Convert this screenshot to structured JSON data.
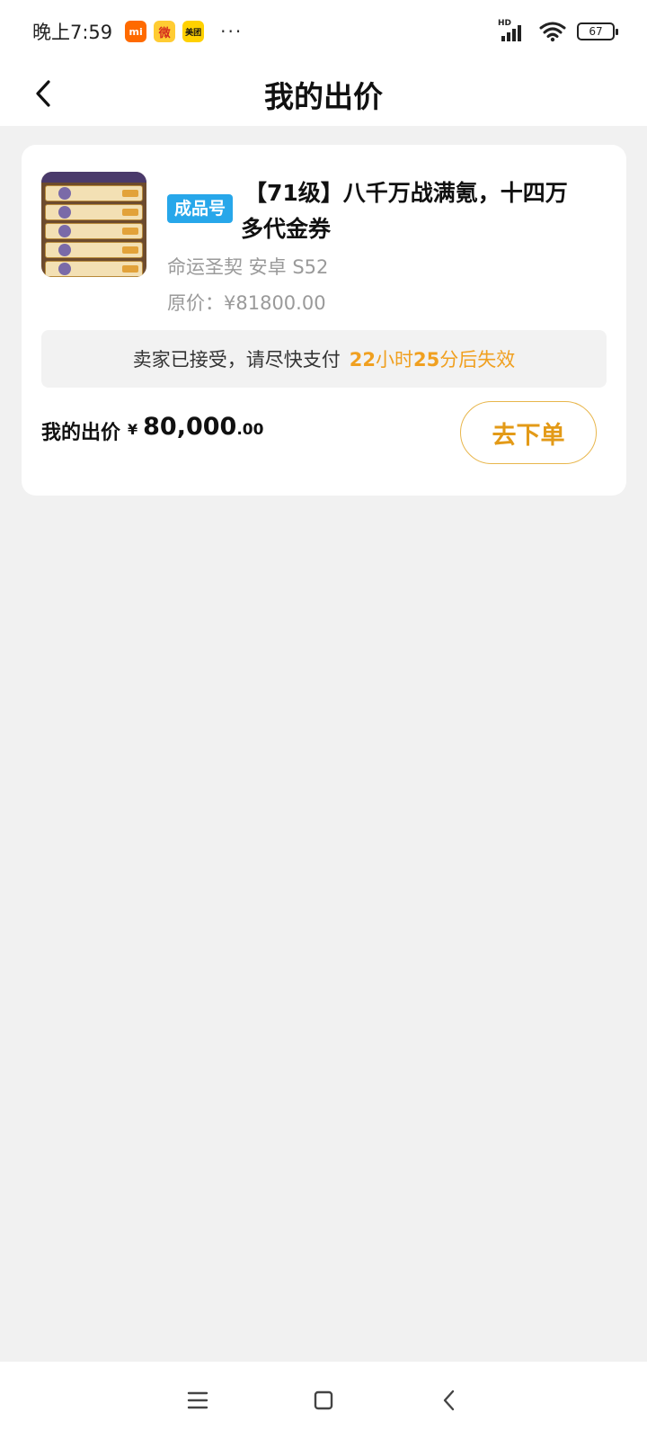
{
  "status_bar": {
    "time": "晚上7:59",
    "apps": [
      {
        "name": "mi-app-icon",
        "glyph": "mi"
      },
      {
        "name": "weibo-app-icon",
        "glyph": "微"
      },
      {
        "name": "meituan-app-icon",
        "glyph": "美团"
      }
    ],
    "more": "···",
    "network_label": "HD",
    "battery": "67"
  },
  "header": {
    "title": "我的出价"
  },
  "offer": {
    "badge": "成品号",
    "title_line1": "【71级】八千万战满氪，十四万",
    "title_line2": "多代金券",
    "meta": "命运圣契 安卓 S52",
    "original_price": "原价：¥81800.00",
    "notice_text": "卖家已接受，请尽快支付",
    "countdown": {
      "hours": "22",
      "hours_unit": "小时",
      "minutes": "25",
      "minutes_unit": "分后失效"
    },
    "my_offer_label": "我的出价",
    "currency": "¥",
    "amount_int": "80,000",
    "amount_dec": ".00",
    "order_button": "去下单"
  },
  "colors": {
    "accent": "#e39a17",
    "badge_bg": "#27a7ea",
    "background": "#f1f1f1"
  }
}
